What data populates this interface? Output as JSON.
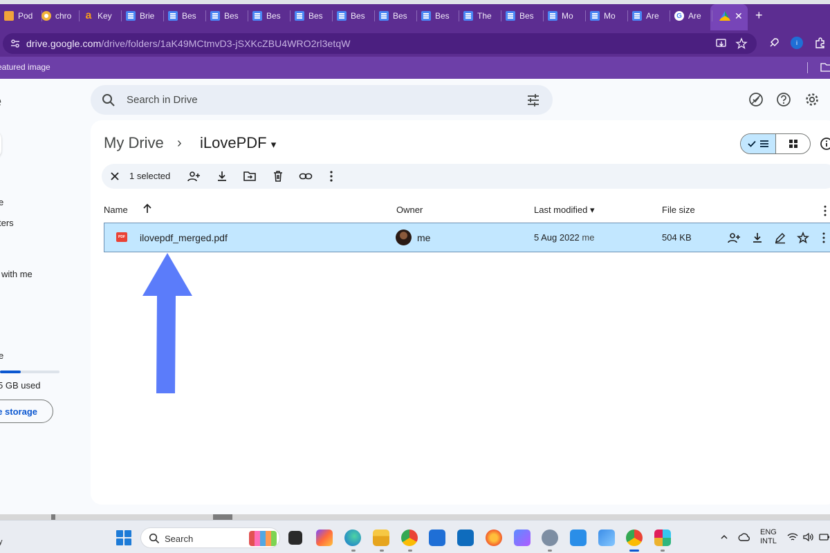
{
  "browser": {
    "tabs": [
      {
        "label": "Pod",
        "icon": "podcast-icon"
      },
      {
        "label": "chro",
        "icon": "chrome-icon"
      },
      {
        "label": "Key",
        "icon": "amazon-icon"
      },
      {
        "label": "Brie",
        "icon": "docs-icon"
      },
      {
        "label": "Bes",
        "icon": "docs-icon"
      },
      {
        "label": "Bes",
        "icon": "docs-icon"
      },
      {
        "label": "Bes",
        "icon": "docs-icon"
      },
      {
        "label": "Bes",
        "icon": "docs-icon"
      },
      {
        "label": "Bes",
        "icon": "docs-icon"
      },
      {
        "label": "Bes",
        "icon": "docs-icon"
      },
      {
        "label": "Bes",
        "icon": "docs-icon"
      },
      {
        "label": "The",
        "icon": "docs-icon"
      },
      {
        "label": "Bes",
        "icon": "docs-icon"
      },
      {
        "label": "Mo",
        "icon": "docs-icon"
      },
      {
        "label": "Mo",
        "icon": "docs-icon"
      },
      {
        "label": "Are",
        "icon": "docs-icon"
      },
      {
        "label": "Are",
        "icon": "google-icon"
      }
    ],
    "active_tab_icon": "google-drive-icon",
    "close_glyph": "✕",
    "new_tab_glyph": "+",
    "url_host": "drive.google.com",
    "url_path": "/drive/folders/1aK49MCtmvD3-jSXKcZBU4WRO2rl3etqW",
    "bookmark_text": "eatured image"
  },
  "drive": {
    "sidebar": {
      "title": "e",
      "items": [
        "e",
        "ters",
        "with me"
      ],
      "storage_label": "e",
      "storage_used_text": "5 GB used",
      "storage_used_fraction": 0.35,
      "storage_button": "e storage"
    },
    "search_placeholder": "Search in Drive",
    "breadcrumb": {
      "root": "My Drive",
      "separator": "›",
      "current": "iLovePDF",
      "current_caret": "▾"
    },
    "selection": {
      "count_text": "1 selected"
    },
    "table": {
      "headers": {
        "name": "Name",
        "owner": "Owner",
        "modified": "Last modified",
        "modified_caret": "▾",
        "size": "File size"
      },
      "rows": [
        {
          "icon_label": "PDF",
          "name": "ilovepdf_merged.pdf",
          "owner": "me",
          "modified_date": "5 Aug 2022",
          "modified_by": "me",
          "size": "504 KB"
        }
      ]
    },
    "colors": {
      "accent": "#0b57d0",
      "selected_row": "#c2e7ff",
      "annotation_arrow": "#5b7cfa",
      "browser_chrome": "#5c2d91"
    }
  },
  "taskbar": {
    "left_text": "y",
    "search_label": "Search",
    "lang_line1": "ENG",
    "lang_line2": "INTL"
  }
}
